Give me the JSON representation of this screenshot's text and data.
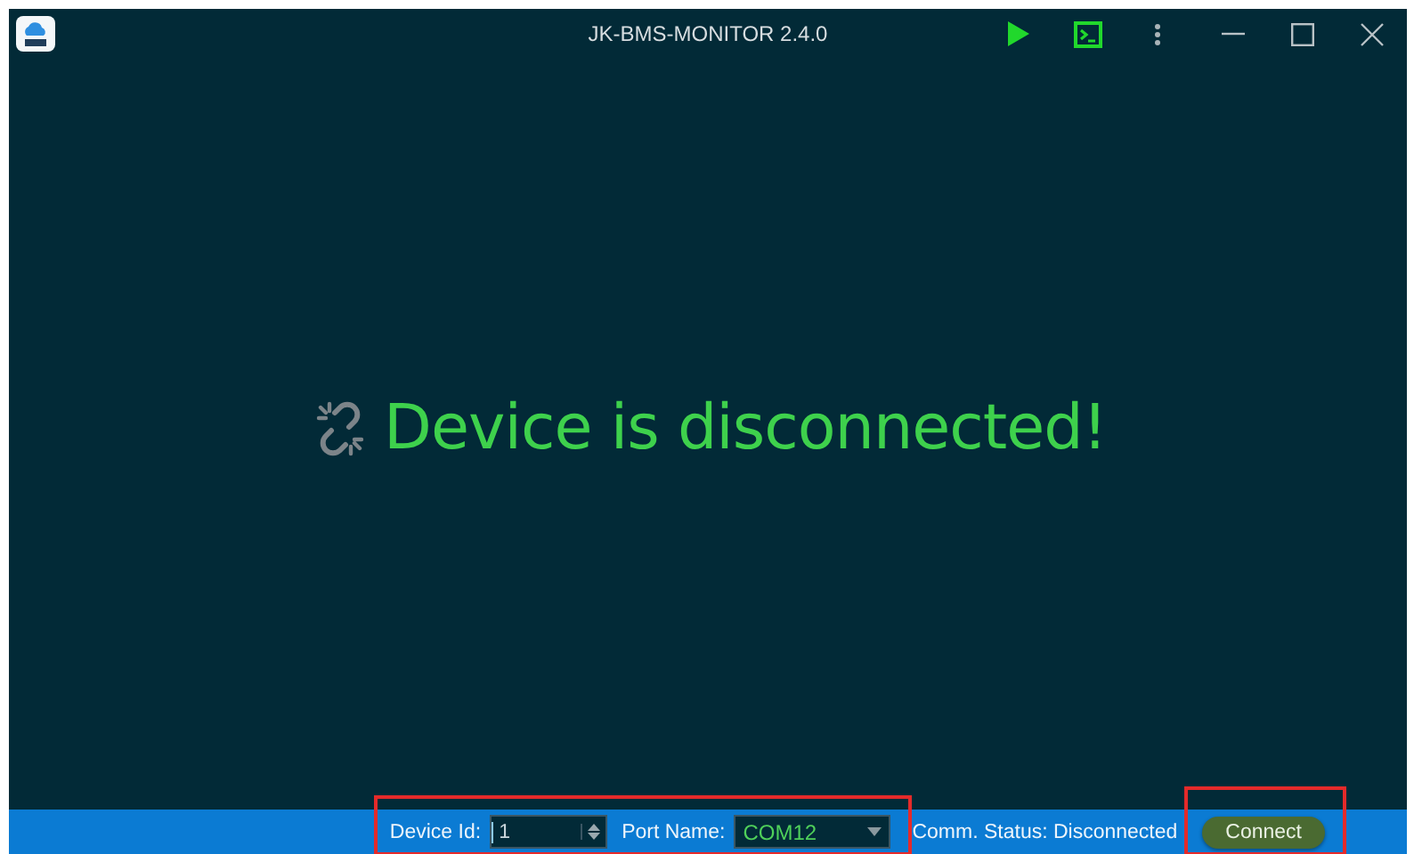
{
  "window": {
    "title": "JK-BMS-MONITOR 2.4.0"
  },
  "toolbar": [
    {
      "kind": "play"
    },
    {
      "kind": "terminal"
    },
    {
      "kind": "more"
    }
  ],
  "window_controls": [
    {
      "kind": "minimize"
    },
    {
      "kind": "maximize"
    },
    {
      "kind": "close"
    }
  ],
  "message": {
    "text": "Device is disconnected!"
  },
  "status_bar": {
    "device_settings": {
      "highlighted": true,
      "device_id": {
        "label": "Device Id:",
        "value": "1"
      },
      "port_name": {
        "label": "Port Name:",
        "value": "COM12"
      }
    },
    "comm_status": "Comm. Status: Disconnected",
    "connect_button": {
      "label": "Connect",
      "highlighted": true
    }
  }
}
